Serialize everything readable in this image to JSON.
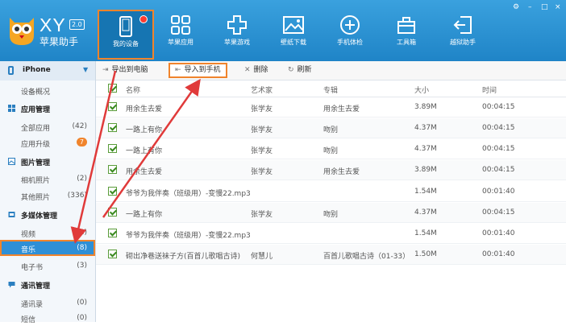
{
  "app": {
    "brand": "XY",
    "version": "2.0",
    "name": "苹果助手"
  },
  "nav": [
    {
      "label": "我的设备",
      "icon": "phone-icon"
    },
    {
      "label": "苹果应用",
      "icon": "apps-grid-icon"
    },
    {
      "label": "苹果游戏",
      "icon": "gamepad-icon"
    },
    {
      "label": "壁纸下载",
      "icon": "picture-icon"
    },
    {
      "label": "手机体检",
      "icon": "plus-circle-icon"
    },
    {
      "label": "工具箱",
      "icon": "toolbox-icon"
    },
    {
      "label": "越狱助手",
      "icon": "exit-icon"
    }
  ],
  "window_controls": {
    "settings": "⚙",
    "minimize": "–",
    "maximize": "□",
    "close": "×"
  },
  "sidebar": {
    "device": "iPhone",
    "overview": "设备概况",
    "sections": [
      {
        "title": "应用管理",
        "items": [
          {
            "label": "全部应用",
            "count": "(42)"
          },
          {
            "label": "应用升级",
            "count": "7"
          }
        ]
      },
      {
        "title": "图片管理",
        "items": [
          {
            "label": "相机照片",
            "count": "(2)"
          },
          {
            "label": "其他照片",
            "count": "(336)"
          }
        ]
      },
      {
        "title": "多媒体管理",
        "items": [
          {
            "label": "视频",
            "count": "(2)"
          },
          {
            "label": "音乐",
            "count": "(8)"
          },
          {
            "label": "电子书",
            "count": "(3)"
          }
        ]
      },
      {
        "title": "通讯管理",
        "items": [
          {
            "label": "通讯录",
            "count": "(0)"
          },
          {
            "label": "短信",
            "count": "(0)"
          }
        ]
      }
    ]
  },
  "toolbar": {
    "export": "导出到电脑",
    "import": "导入到手机",
    "delete": "删除",
    "refresh": "刷新"
  },
  "table": {
    "headers": [
      "名称",
      "艺术家",
      "专辑",
      "大小",
      "时间"
    ],
    "rows": [
      [
        "用余生去爱",
        "张学友",
        "用余生去爱",
        "3.89M",
        "00:04:15"
      ],
      [
        "一路上有你",
        "张学友",
        "吻别",
        "4.37M",
        "00:04:15"
      ],
      [
        "一路上有你",
        "张学友",
        "吻别",
        "4.37M",
        "00:04:15"
      ],
      [
        "用余生去爱",
        "张学友",
        "用余生去爱",
        "3.89M",
        "00:04:15"
      ],
      [
        "爷爷为我伴奏（班级用）-变慢22.mp3",
        "",
        "",
        "1.54M",
        "00:01:40"
      ],
      [
        "一路上有你",
        "张学友",
        "吻别",
        "4.37M",
        "00:04:15"
      ],
      [
        "爷爷为我伴奏（班级用）-变慢22.mp3",
        "",
        "",
        "1.54M",
        "00:01:40"
      ],
      [
        "砌出净巷送袜子方(百首儿歌唱古诗)",
        "何慧儿",
        "百首儿歌唱古诗（01-33）",
        "1.50M",
        "00:01:40"
      ]
    ]
  },
  "colors": {
    "topbar": "#2a93d5",
    "highlight": "#f0842c",
    "arrow": "#e03a3a",
    "selected": "#2e8fd6"
  }
}
